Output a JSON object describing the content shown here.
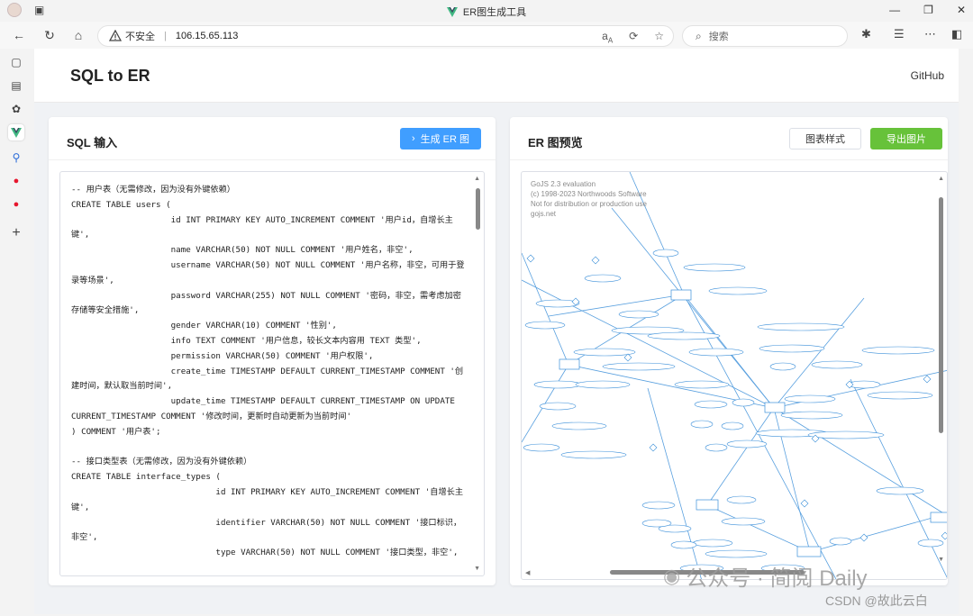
{
  "browser": {
    "tab_title": "ER图生成工具",
    "address": {
      "security_label": "不安全",
      "url": "106.15.65.113"
    },
    "search_placeholder": "搜索"
  },
  "app": {
    "title": "SQL to ER",
    "github_label": "GitHub"
  },
  "sql_panel": {
    "title": "SQL 输入",
    "generate_button": "生成 ER 图",
    "code": "-- 用户表（无需修改，因为没有外键依赖）\nCREATE TABLE users (\n                    id INT PRIMARY KEY AUTO_INCREMENT COMMENT '用户id，自增长主键',\n                    name VARCHAR(50) NOT NULL COMMENT '用户姓名，非空',\n                    username VARCHAR(50) NOT NULL COMMENT '用户名称，非空，可用于登录等场景',\n                    password VARCHAR(255) NOT NULL COMMENT '密码，非空，需考虑加密存储等安全措施',\n                    gender VARCHAR(10) COMMENT '性别',\n                    info TEXT COMMENT '用户信息，较长文本内容用 TEXT 类型',\n                    permission VARCHAR(50) COMMENT '用户权限',\n                    create_time TIMESTAMP DEFAULT CURRENT_TIMESTAMP COMMENT '创建时间，默认取当前时间',\n                    update_time TIMESTAMP DEFAULT CURRENT_TIMESTAMP ON UPDATE CURRENT_TIMESTAMP COMMENT '修改时间，更新时自动更新为当前时间'\n) COMMENT '用户表';\n\n-- 接口类型表（无需修改，因为没有外键依赖）\nCREATE TABLE interface_types (\n                             id INT PRIMARY KEY AUTO_INCREMENT COMMENT '自增长主键',\n                             identifier VARCHAR(50) NOT NULL COMMENT '接口标识，非空',\n                             type VARCHAR(50) NOT NULL COMMENT '接口类型，非空',"
  },
  "er_panel": {
    "title": "ER 图预览",
    "style_button": "图表样式",
    "export_button": "导出图片",
    "gojs_notice": [
      "GoJS 2.3 evaluation",
      "(c) 1998-2023 Northwoods Software",
      "Not for distribution or production use",
      "gojs.net"
    ]
  },
  "overlay": {
    "watermark": "公众号 · 简阅 Daily",
    "csdn": "CSDN @故此云白"
  },
  "colors": {
    "primary": "#409eff",
    "success": "#67c23a",
    "diagram_line": "#3b8fd9"
  }
}
